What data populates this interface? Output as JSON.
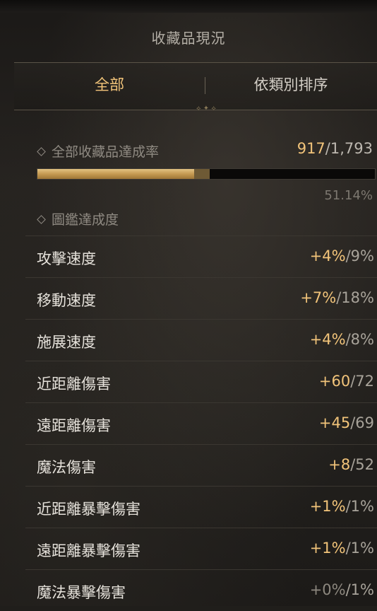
{
  "header": {
    "title": "收藏品現況"
  },
  "tabs": [
    {
      "label": "全部",
      "active": true
    },
    {
      "label": "依類別排序",
      "active": false
    }
  ],
  "total": {
    "label": "全部收藏品達成率",
    "current": "917",
    "max": "/1,793",
    "percent": "51.14%",
    "progress": 0.5114
  },
  "codex": {
    "label": "圖鑑達成度",
    "rows": [
      {
        "label": "攻擊速度",
        "current": "+4%",
        "max": "/9%"
      },
      {
        "label": "移動速度",
        "current": "+7%",
        "max": "/18%"
      },
      {
        "label": "施展速度",
        "current": "+4%",
        "max": "/8%"
      },
      {
        "label": "近距離傷害",
        "current": "+60",
        "max": "/72"
      },
      {
        "label": "遠距離傷害",
        "current": "+45",
        "max": "/69"
      },
      {
        "label": "魔法傷害",
        "current": "+8",
        "max": "/52"
      },
      {
        "label": "近距離暴擊傷害",
        "current": "+1%",
        "max": "/1%"
      },
      {
        "label": "遠距離暴擊傷害",
        "current": "+1%",
        "max": "/1%"
      },
      {
        "label": "魔法暴擊傷害",
        "current": "+0%",
        "max": "/1%"
      }
    ]
  },
  "colors": {
    "accent": "#f2c47a",
    "text": "#e6e2db",
    "muted": "#8f8a82"
  },
  "icons": [
    "diamond-icon",
    "ornament-icon"
  ]
}
